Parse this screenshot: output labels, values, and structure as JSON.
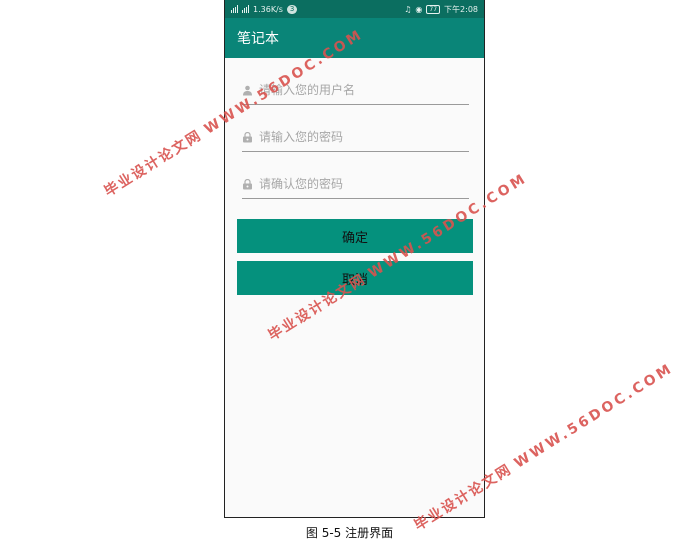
{
  "statusbar": {
    "signal1": "⁴⁶",
    "signal2": "⁴⁶",
    "speed": "1.36K/s",
    "notif": "3",
    "battery": "77",
    "time": "下午2:08"
  },
  "appbar": {
    "title": "笔记本"
  },
  "form": {
    "username_placeholder": "请输入您的用户名",
    "password_placeholder": "请输入您的密码",
    "confirm_placeholder": "请确认您的密码",
    "confirm_button": "确定",
    "cancel_button": "取消"
  },
  "caption": "图 5-5 注册界面",
  "watermark": {
    "url": "WWW.56DOC.COM",
    "cn": "毕业设计论文网"
  },
  "colors": {
    "statusbar": "#0b6e60",
    "appbar": "#0a8578",
    "button": "#05917d",
    "watermark": "#d9534f"
  },
  "icons": [
    "user-icon",
    "lock-icon",
    "lock-icon"
  ]
}
